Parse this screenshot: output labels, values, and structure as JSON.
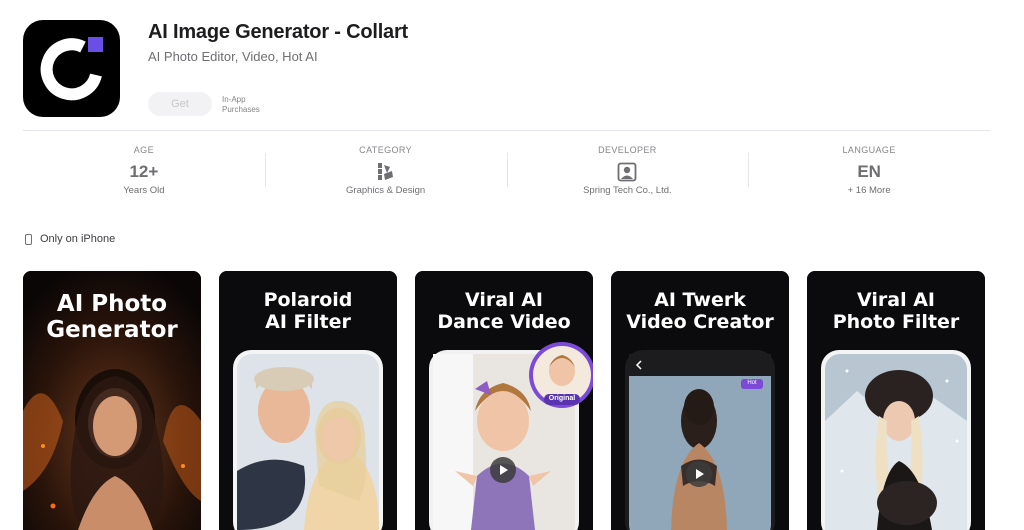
{
  "app": {
    "title": "AI Image Generator - Collart",
    "subtitle": "AI Photo Editor, Video, Hot AI",
    "get_label": "Get",
    "in_app_line1": "In-App",
    "in_app_line2": "Purchases"
  },
  "info": {
    "age": {
      "label": "AGE",
      "value": "12+",
      "sub": "Years Old"
    },
    "category": {
      "label": "CATEGORY",
      "icon": "graphics-design-icon",
      "sub": "Graphics & Design"
    },
    "developer": {
      "label": "DEVELOPER",
      "icon": "developer-person-icon",
      "sub": "Spring Tech Co., Ltd."
    },
    "language": {
      "label": "LANGUAGE",
      "value": "EN",
      "sub": "+ 16 More"
    }
  },
  "platform_note": "Only on iPhone",
  "screenshots": [
    {
      "line1": "AI Photo",
      "line2": "Generator"
    },
    {
      "line1": "Polaroid",
      "line2": "AI Filter"
    },
    {
      "line1": "Viral AI",
      "line2": "Dance Video",
      "badge": "Original"
    },
    {
      "line1": "AI Twerk",
      "line2": "Video Creator",
      "badge": "Hot"
    },
    {
      "line1": "Viral AI",
      "line2": "Photo Filter"
    }
  ],
  "colors": {
    "accent_purple": "#6b4ee6",
    "icon_bg": "#000000"
  }
}
